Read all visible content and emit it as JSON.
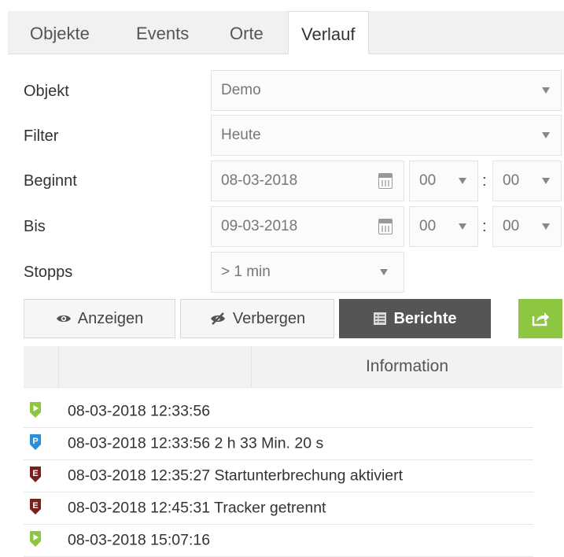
{
  "tabs": [
    {
      "label": "Objekte"
    },
    {
      "label": "Events"
    },
    {
      "label": "Orte"
    },
    {
      "label": "Verlauf"
    }
  ],
  "active_tab": "Verlauf",
  "form": {
    "objekt": {
      "label": "Objekt",
      "value": "Demo"
    },
    "filter": {
      "label": "Filter",
      "value": "Heute"
    },
    "beginnt": {
      "label": "Beginnt",
      "date": "08-03-2018",
      "hour": "00",
      "minute": "00"
    },
    "bis": {
      "label": "Bis",
      "date": "09-03-2018",
      "hour": "00",
      "minute": "00"
    },
    "stopps": {
      "label": "Stopps",
      "value": "> 1 min"
    },
    "time_separator": ":"
  },
  "buttons": {
    "show": "Anzeigen",
    "hide": "Verbergen",
    "reports": "Berichte"
  },
  "table": {
    "header_info": "Information",
    "rows": [
      {
        "icon": "route-start-icon",
        "color": "#8dc63f",
        "letter": "",
        "text": "08-03-2018 12:33:56"
      },
      {
        "icon": "parking-icon",
        "color": "#2d8fd5",
        "letter": "P",
        "text": "08-03-2018 12:33:56 2 h 33 Min. 20 s"
      },
      {
        "icon": "event-icon",
        "color": "#7a1f1f",
        "letter": "E",
        "text": "08-03-2018 12:35:27 Startunterbrechung aktiviert"
      },
      {
        "icon": "event-icon",
        "color": "#7a1f1f",
        "letter": "E",
        "text": "08-03-2018 12:45:31 Tracker getrennt"
      },
      {
        "icon": "route-end-icon",
        "color": "#8dc63f",
        "letter": "",
        "text": "08-03-2018 15:07:16"
      }
    ]
  },
  "colors": {
    "accent": "#8dc63f",
    "dark_button": "#555555"
  }
}
